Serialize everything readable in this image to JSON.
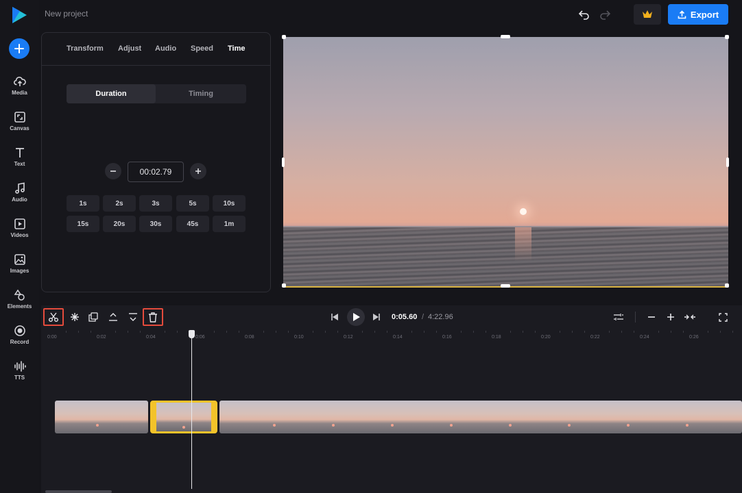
{
  "app": {
    "project_title": "New project"
  },
  "sidebar": {
    "items": [
      {
        "label": "Media",
        "icon": "upload-cloud-icon"
      },
      {
        "label": "Canvas",
        "icon": "canvas-icon"
      },
      {
        "label": "Text",
        "icon": "text-icon"
      },
      {
        "label": "Audio",
        "icon": "music-note-icon"
      },
      {
        "label": "Videos",
        "icon": "video-icon"
      },
      {
        "label": "Images",
        "icon": "image-icon"
      },
      {
        "label": "Elements",
        "icon": "shapes-icon"
      },
      {
        "label": "Record",
        "icon": "record-icon"
      },
      {
        "label": "TTS",
        "icon": "waveform-icon"
      }
    ]
  },
  "header": {
    "export_label": "Export"
  },
  "panel": {
    "tabs": [
      "Transform",
      "Adjust",
      "Audio",
      "Speed",
      "Time"
    ],
    "active_tab": "Time",
    "segments": [
      "Duration",
      "Timing"
    ],
    "active_segment": "Duration",
    "duration_value": "00:02.79",
    "presets": [
      "1s",
      "2s",
      "3s",
      "5s",
      "10s",
      "15s",
      "20s",
      "30s",
      "45s",
      "1m"
    ]
  },
  "playback": {
    "current_time": "0:05.60",
    "separator": "/",
    "total_time": "4:22.96"
  },
  "ruler": {
    "labels": [
      "0:00",
      "0:02",
      "0:04",
      "0:06",
      "0:08",
      "0:10",
      "0:12",
      "0:14",
      "0:16",
      "0:18",
      "0:20",
      "0:22",
      "0:24",
      "0:26"
    ]
  },
  "colors": {
    "accent": "#1a7cf5",
    "selection": "#f3c32a",
    "highlight": "#e54b3c"
  }
}
